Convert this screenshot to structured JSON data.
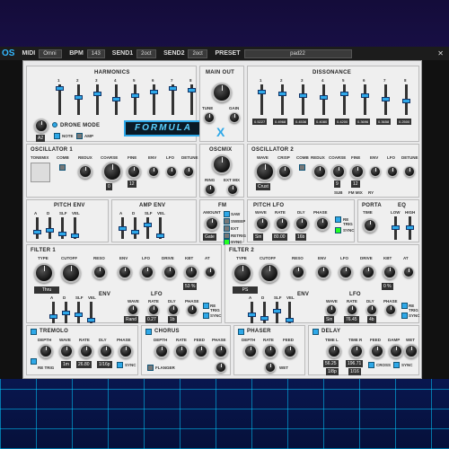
{
  "topbar": {
    "logo": "OS",
    "midi_label": "MIDI",
    "midi": "Omni",
    "bpm_label": "BPM",
    "bpm": "143",
    "send1_label": "SEND1",
    "send1": "2oct",
    "send2_label": "SEND2",
    "send2": "2oct",
    "preset_label": "PRESET",
    "preset": "pad22"
  },
  "sections": {
    "harmonics": "HARMONICS",
    "main_out": "MAIN OUT",
    "dissonance": "DISSONANCE",
    "drone_mode": "DRONE MODE",
    "osc1": "OSCILLATOR 1",
    "oscmix": "OSCMIX",
    "osc2": "OSCILLATOR 2",
    "pitch_env": "PITCH ENV",
    "amp_env": "AMP ENV",
    "fm": "FM",
    "pitch_lfo": "PITCH LFO",
    "porta": "PORTA",
    "eq": "EQ",
    "filter1": "FILTER 1",
    "filter2": "FILTER 2",
    "env": "ENV",
    "lfo": "LFO",
    "tremolo": "TREMOLO",
    "chorus": "CHORUS",
    "phaser": "PHASER",
    "delay": "DELAY"
  },
  "harmonics_nums": [
    "1",
    "2",
    "3",
    "4",
    "5",
    "6",
    "7",
    "8"
  ],
  "dissonance_nums": [
    "1",
    "2",
    "3",
    "4",
    "5",
    "6",
    "7",
    "8"
  ],
  "dissonance_vals": [
    "0.5227",
    "0.4968",
    "0.4536",
    "0.4080",
    "0.4200",
    "0.3696",
    "0.3658",
    "0.2500"
  ],
  "main_out": {
    "tune": "TUNE",
    "gain": "GAIN"
  },
  "drone": {
    "key": "A2",
    "note": "NOTE",
    "amp": "AMP"
  },
  "formula": "FORMULA",
  "osc1": {
    "tonemix": "TONEMIX",
    "comb": "COMB",
    "redux": "REDUX",
    "coarse": "COARSE",
    "fine": "FINE",
    "env": "ENV",
    "lfo": "LFO",
    "detune": "DETUNE",
    "coarse_val": "0",
    "fine_val": "12"
  },
  "oscmix": {
    "ring": "RING",
    "extmix": "EXT MIX",
    "ext": "EXT"
  },
  "osc2": {
    "wave": "WAVE",
    "crisp": "CRISP",
    "comb": "COMB",
    "redux": "REDUX",
    "coarse": "COARSE",
    "fine": "FINE",
    "env": "ENV",
    "lfo": "LFO",
    "detune": "DETUNE",
    "wave_val": "Crust",
    "fine_val": "12",
    "coarse_val": "9",
    "sub": "SUB",
    "fmmix": "FM MIX",
    "ry": "RY"
  },
  "env_labels": [
    "A",
    "D",
    "SLF",
    "VEL"
  ],
  "fm": {
    "amount": "AMOUNT",
    "mode": "Gate",
    "saw": "SAW",
    "sweep": "SWEEP",
    "ext": "EXT",
    "retrig": "RETRIG",
    "sync": "SYNC"
  },
  "pitch_lfo": {
    "wave": "WAVE",
    "rate": "RATE",
    "dly": "DLY",
    "phase": "PHASE",
    "wave_val": "Sin",
    "rate_val": "80.00",
    "dly_val": "16b",
    "retrig": "RE TRIG",
    "sync": "SYNC"
  },
  "porta": {
    "time": "TIME"
  },
  "eq": {
    "low": "LOW",
    "high": "HIGH"
  },
  "filter1": {
    "type": "TYPE",
    "cutoff": "CUTOFF",
    "reso": "RESO",
    "env": "ENV",
    "lfo": "LFO",
    "drive": "DRIVE",
    "kbt": "KBT",
    "at": "AT",
    "type_val": "Thru",
    "kbt_val": "53 %"
  },
  "filter2": {
    "type": "TYPE",
    "cutoff": "CUTOFF",
    "reso": "RESO",
    "env": "ENV",
    "lfo": "LFO",
    "drive": "DRIVE",
    "kbt": "KBT",
    "at": "AT",
    "type_val": "PS",
    "kbt_val": "0 %"
  },
  "lfo1": {
    "wave": "WAVE",
    "rate": "RATE",
    "dly": "DLY",
    "phase": "PHASE",
    "wave_val": "Rand",
    "rate_val": "0.27",
    "dly_val": "1b",
    "retrig": "RE TRIG",
    "sync": "SYNC"
  },
  "lfo2": {
    "wave": "WAVE",
    "rate": "RATE",
    "dly": "DLY",
    "phase": "PHASE",
    "wave_val": "Sin",
    "rate_val": "76.45",
    "dly_val": "4b",
    "retrig": "RE TRIG",
    "sync": "SYNC"
  },
  "tremolo": {
    "depth": "DEPTH",
    "wave": "WAVE",
    "rate": "RATE",
    "dly": "DLY",
    "phase": "PHASE",
    "rate_val": "26.80",
    "dly_val": "1/16p",
    "retrig": "RE TRIG",
    "sync": "SYNC",
    "ws": "1m"
  },
  "chorus": {
    "depth": "DEPTH",
    "rate": "RATE",
    "feed": "FEED",
    "phase": "PHASE",
    "flanger": "FLANGER"
  },
  "phaser": {
    "depth": "DEPTH",
    "rate": "RATE",
    "feed": "FEED",
    "wet": "WET"
  },
  "delay": {
    "time_l": "TIME L",
    "time_r": "TIME R",
    "feed": "FEED",
    "damp": "DAMP",
    "wet": "WET",
    "time_l_val": "56.25",
    "time_r_val": "196.71",
    "l_val": "1/8p",
    "r_val": "1/16",
    "cross": "CROSS",
    "sync": "SYNC"
  }
}
